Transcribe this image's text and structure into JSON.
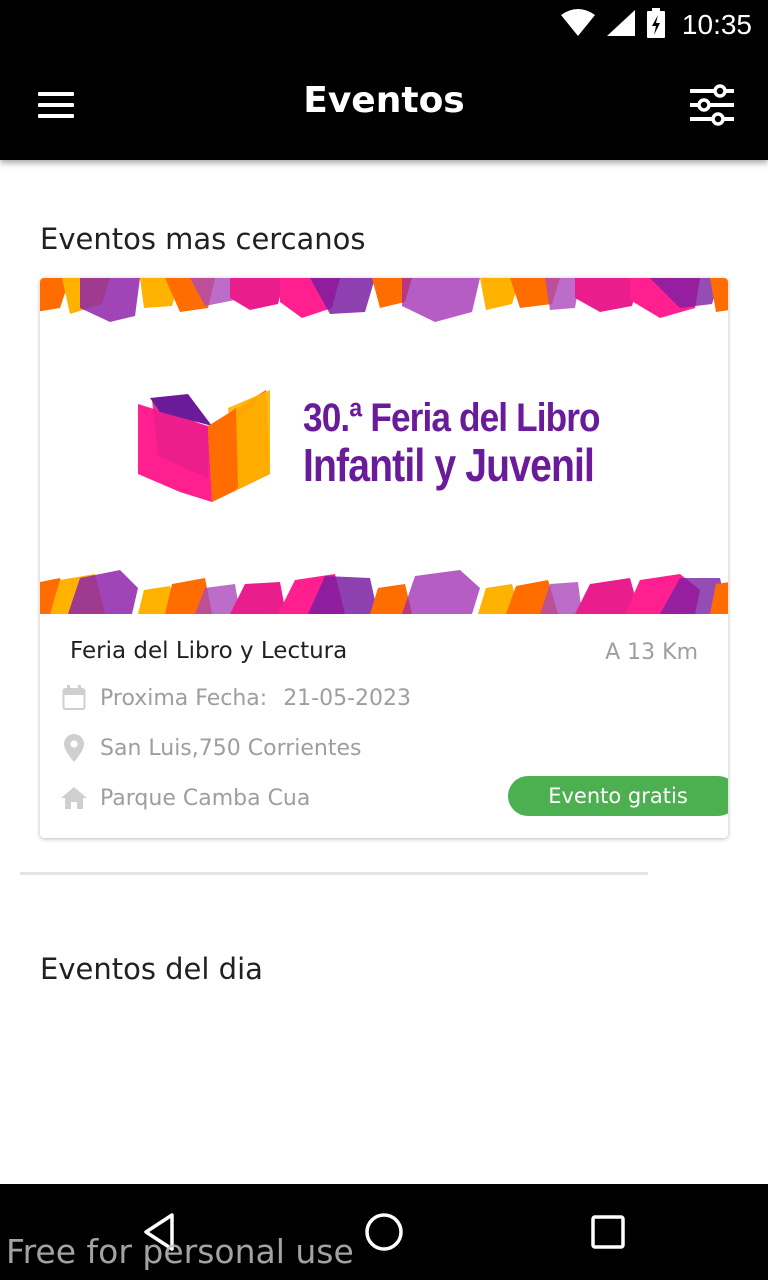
{
  "status_bar": {
    "time": "10:35",
    "icons": [
      "wifi-icon",
      "cell-signal-icon",
      "battery-charging-icon"
    ]
  },
  "app_bar": {
    "title": "Eventos",
    "left_icon": "menu-icon",
    "right_icon": "filter-sliders-icon"
  },
  "sections": {
    "nearest_title": "Eventos mas cercanos",
    "today_title": "Eventos del dia"
  },
  "event": {
    "banner": {
      "line1": "30.ª Feria del Libro",
      "line2": "Infantil y Juvenil",
      "colors": [
        "#e91e8c",
        "#ff6d00",
        "#ffb300",
        "#7b1fa2"
      ]
    },
    "name": "Feria del Libro y Lectura",
    "distance": "A 13 Km",
    "date_label": "Proxima Fecha:",
    "date_value": "21-05-2023",
    "address": "San Luis,750 Corrientes",
    "place": "Parque Camba Cua",
    "badge": "Evento gratis",
    "badge_color": "#4caf50",
    "icons": [
      "calendar-icon",
      "location-pin-icon",
      "home-icon"
    ]
  },
  "nav_bar": {
    "icons": [
      "back-icon",
      "home-circle-icon",
      "recents-icon"
    ]
  },
  "watermark": "Free for personal use"
}
